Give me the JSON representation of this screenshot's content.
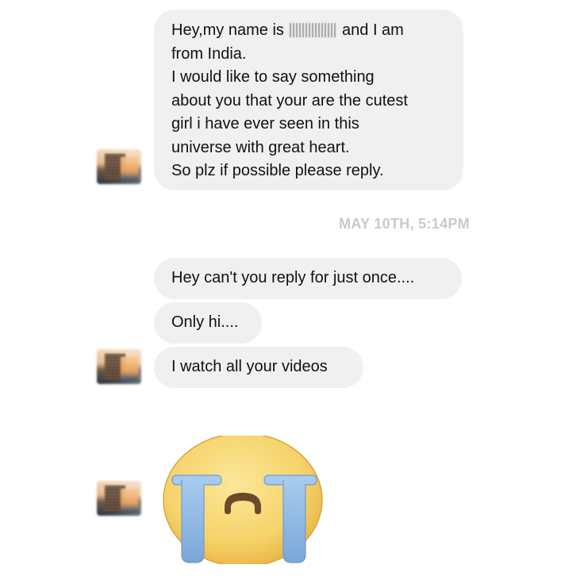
{
  "conversation": {
    "messages": [
      {
        "lines": [
          {
            "before": "Hey,my name is",
            "after": "and I am"
          },
          "from India.",
          "I would like to say something",
          "about you that your are the cutest",
          "girl i have ever seen in this",
          "universe with great heart.",
          "So plz if possible please reply."
        ]
      },
      {
        "text": "Hey can't you reply for just once...."
      },
      {
        "text": "Only hi...."
      },
      {
        "text": "I watch all your videos"
      },
      {
        "emoji": "crying-face-sticker"
      }
    ],
    "timestamp": "MAY 10TH, 5:14PM"
  },
  "colors": {
    "bubble_background": "#f1f0f0",
    "timestamp_text": "#c7cad1",
    "emoji_face": "#f6d36a",
    "tears": "#8fb8e3"
  },
  "icons": {
    "avatar": "sender-avatar",
    "sticker": "crying-face-sticker"
  }
}
